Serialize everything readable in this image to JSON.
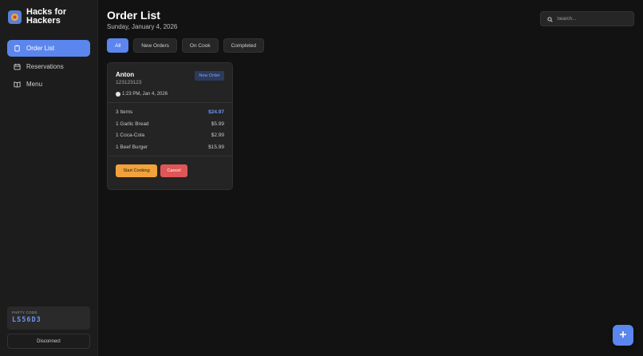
{
  "brand": {
    "name": "Hacks for Hackers",
    "logo_icon": "restaurant-icon"
  },
  "sidebar": {
    "items": [
      {
        "label": "Order List",
        "icon": "clipboard-icon",
        "active": true
      },
      {
        "label": "Reservations",
        "icon": "calendar-icon",
        "active": false
      },
      {
        "label": "Menu",
        "icon": "book-icon",
        "active": false
      }
    ],
    "party_code_label": "PARTY CODE",
    "party_code": "LS56D3",
    "disconnect_label": "Disconnect"
  },
  "header": {
    "title": "Order List",
    "date": "Sunday, January 4, 2026",
    "search_placeholder": "Search..."
  },
  "filters": [
    {
      "label": "All",
      "active": true
    },
    {
      "label": "New Orders",
      "active": false
    },
    {
      "label": "On Cook",
      "active": false
    },
    {
      "label": "Completed",
      "active": false
    }
  ],
  "orders": [
    {
      "name": "Anton",
      "id": "123123123",
      "status": "New Order",
      "time": "1:23 PM, Jan 4, 2026",
      "item_count": "3 Items",
      "total": "$24.97",
      "items": [
        {
          "label": "1 Garlic Bread",
          "price": "$5.99"
        },
        {
          "label": "1 Coca-Cola",
          "price": "$2.99"
        },
        {
          "label": "1 Beef Burger",
          "price": "$15.99"
        }
      ],
      "start_label": "Start Cooking",
      "cancel_label": "Cancel"
    }
  ],
  "colors": {
    "accent": "#5b86ee",
    "start": "#f2a23a",
    "cancel": "#e05656",
    "background": "#121212"
  }
}
